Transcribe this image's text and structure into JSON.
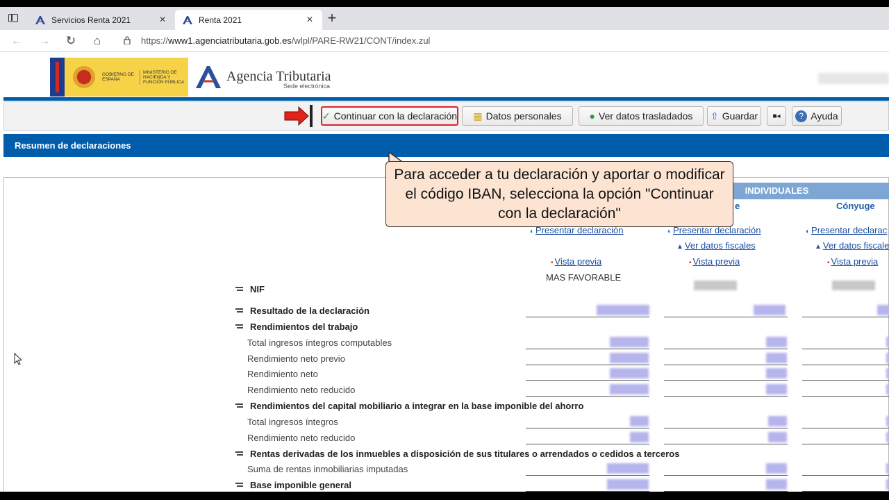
{
  "browser": {
    "tabs": [
      {
        "title": "Servicios Renta 2021",
        "active": false,
        "favicon": "aeat-favicon"
      },
      {
        "title": "Renta 2021",
        "active": true,
        "favicon": "aeat-favicon"
      }
    ],
    "url_prefix": "https://",
    "url_host": "www1.agenciatributaria.gob.es",
    "url_path": "/wlpl/PARE-RW21/CONT/index.zul"
  },
  "header": {
    "gov_line1": "GOBIERNO DE ESPAÑA",
    "gov_line2": "MINISTERIO DE HACIENDA Y FUNCIÓN PÚBLICA",
    "agency_name": "Agencia Tributaria",
    "agency_sub": "Sede electrónica"
  },
  "toolbar": {
    "continue_label": "Continuar con la declaración",
    "personal_label": "Datos personales",
    "transferred_label": "Ver datos trasladados",
    "save_label": "Guardar",
    "help_label": "Ayuda"
  },
  "section": {
    "title": "Resumen de declaraciones"
  },
  "columns": {
    "group_header": "INDIVIDUALES",
    "col2_partial": "e",
    "col3": "Cónyuge",
    "present_link": "Presentar declaración",
    "present_link_cut": "Presentar declarac",
    "fiscal_link": "Ver datos fiscales",
    "fiscal_link_cut": "Ver datos fiscale",
    "preview_link": "Vista previa",
    "favorable": "MAS FAVORABLE"
  },
  "rows": [
    {
      "label": "NIF",
      "bold": true
    },
    {
      "label": "Resultado de la declaración",
      "bold": true
    },
    {
      "label": "Rendimientos del trabajo",
      "bold": true
    },
    {
      "label": "Total ingresos íntegros computables",
      "bold": false
    },
    {
      "label": "Rendimiento neto previo",
      "bold": false
    },
    {
      "label": "Rendimiento neto",
      "bold": false
    },
    {
      "label": "Rendimiento neto reducido",
      "bold": false
    },
    {
      "label": "Rendimientos del capital mobiliario a integrar en la base imponible del ahorro",
      "bold": true
    },
    {
      "label": "Total ingresos íntegros",
      "bold": false
    },
    {
      "label": "Rendimiento neto reducido",
      "bold": false
    },
    {
      "label": "Rentas derivadas de los inmuebles a disposición de sus titulares o arrendados o cedidos a terceros",
      "bold": true
    },
    {
      "label": "Suma de rentas inmobiliarias imputadas",
      "bold": false
    },
    {
      "label": "Base imponible general",
      "bold": true
    }
  ],
  "tooltip": {
    "text": "Para acceder a tu declaración y aportar o modificar el código IBAN, selecciona la opción \"Continuar con la declaración\""
  },
  "colors": {
    "brand_blue": "#005dab",
    "highlight_red": "#d8232a",
    "tooltip_bg": "#fde4d2",
    "link_blue": "#1a4fa0"
  }
}
